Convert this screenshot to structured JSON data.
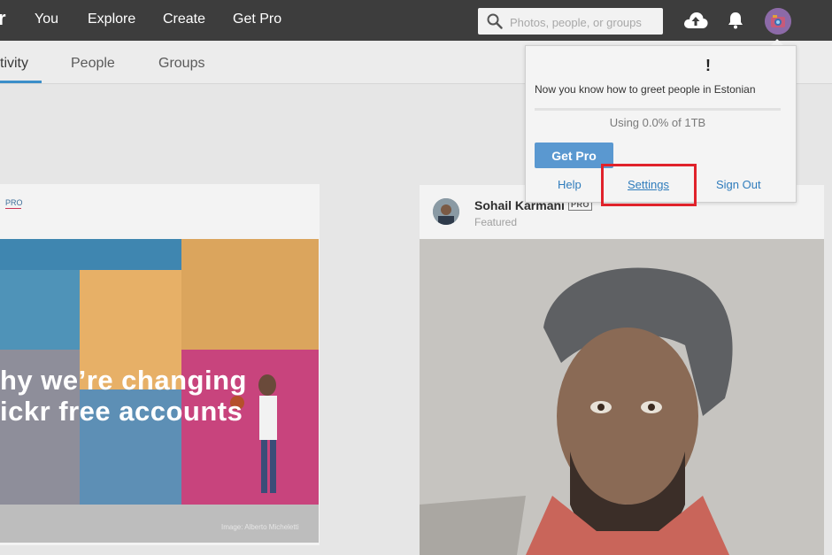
{
  "nav": {
    "logo_fragment": "r",
    "links": [
      "You",
      "Explore",
      "Create",
      "Get Pro"
    ],
    "search_placeholder": "Photos, people, or groups",
    "icons": [
      "search-icon",
      "upload-cloud-icon",
      "notification-bell-icon",
      "avatar"
    ]
  },
  "subnav": {
    "tabs": [
      "tivity",
      "People",
      "Groups"
    ],
    "active_index": 0,
    "accent_color": "#3b8ec9"
  },
  "left_card": {
    "pro_badge": "PRO",
    "promo_lines": [
      "hy we’re changing",
      "ickr free accounts"
    ],
    "credit": "Image: Alberto Micheletti"
  },
  "right_card": {
    "author": "Sohail Karmani",
    "pro_tag": "PRO",
    "subtitle": "Featured"
  },
  "dropdown": {
    "alert_mark": "!",
    "greeting": "Now you know how to greet people in Estonian",
    "usage": "Using 0.0% of 1TB",
    "usage_fraction": 0.0,
    "get_pro_label": "Get Pro",
    "help_label": "Help",
    "settings_label": "Settings",
    "sign_out_label": "Sign Out",
    "highlight_color": "#e0222b"
  }
}
